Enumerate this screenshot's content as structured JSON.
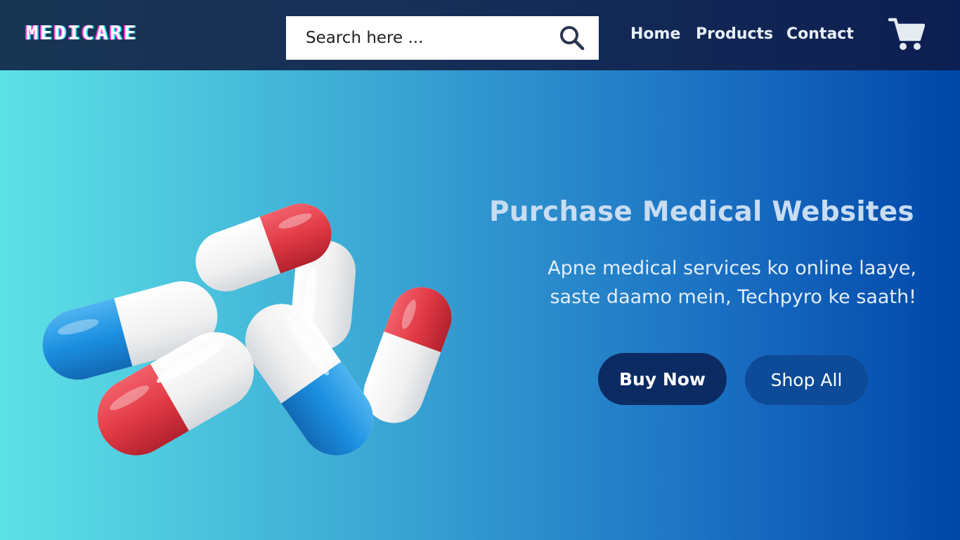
{
  "header": {
    "logo": "MEDICARE",
    "search": {
      "placeholder": "Search here ...",
      "value": ""
    },
    "nav": [
      {
        "label": "Home"
      },
      {
        "label": "Products"
      },
      {
        "label": "Contact"
      }
    ],
    "icons": {
      "search": "search-icon",
      "cart": "cart-icon"
    }
  },
  "hero": {
    "title": "Purchase Medical  Websites",
    "subtitle_lines": [
      "Apne medical services ko online laaye,",
      "saste daamo mein, Techpyro ke saath!"
    ],
    "buttons": {
      "buy": "Buy Now",
      "shop": "Shop All"
    },
    "image": "capsule-pills-image"
  },
  "colors": {
    "header_bg": "#162f57",
    "hero_gradient_start": "#5de2e6",
    "hero_gradient_end": "#0046a8",
    "buy_button": "#0d2b63",
    "shop_button": "#0d4a97",
    "pill_red": "#e23a45",
    "pill_blue": "#1b8fe0"
  }
}
